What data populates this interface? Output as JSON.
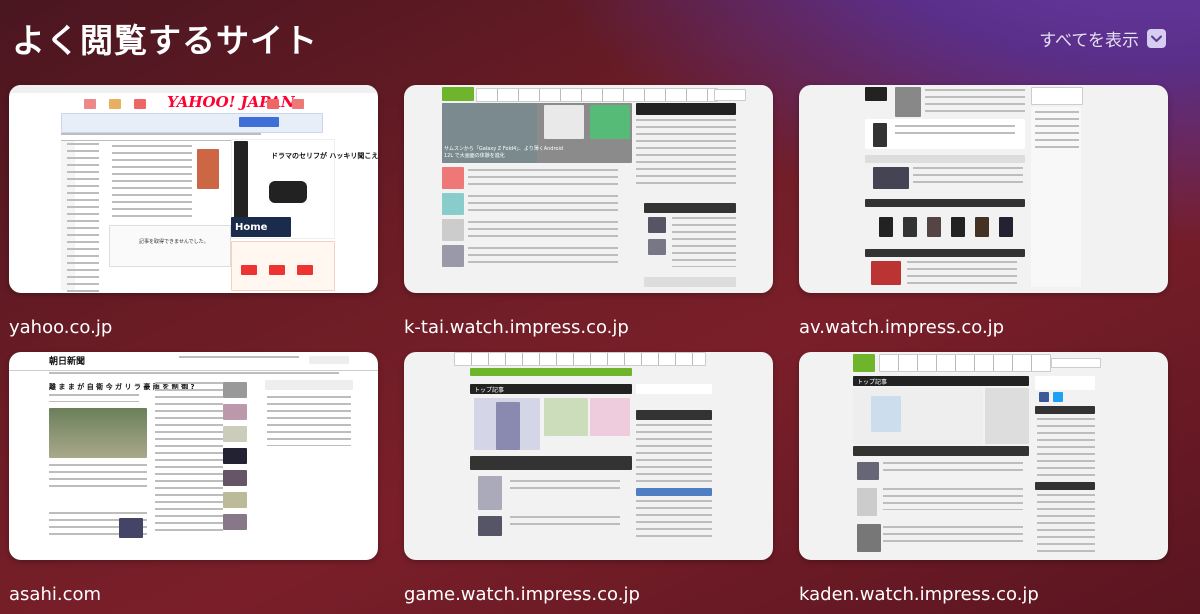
{
  "header": {
    "title": "よく閲覧するサイト",
    "show_all_label": "すべてを表示"
  },
  "tiles": [
    {
      "label": "yahoo.co.jp",
      "preview": {
        "logo": "YAHOO! JAPAN",
        "promo_text": "ドラマのセリフが ハッキリ聞こえる",
        "promo_footer": "Home",
        "notice": "記事を取得できませんでした。"
      }
    },
    {
      "label": "k-tai.watch.impress.co.jp",
      "preview": {
        "headline": "サムスンから「Galaxy Z Fold4」、より薄くAndroid 12L で大画面の体験を進化"
      }
    },
    {
      "label": "av.watch.impress.co.jp"
    },
    {
      "label": "asahi.com",
      "preview": {
        "logo": "朝日新聞",
        "headline": "離 ま ま が 自 衛 今 ガ リ ラ 豪 雨 を 制 御 ?"
      }
    },
    {
      "label": "game.watch.impress.co.jp",
      "preview": {
        "section": "トップ記事"
      }
    },
    {
      "label": "kaden.watch.impress.co.jp",
      "preview": {
        "section": "トップ記事"
      }
    }
  ],
  "colors": {
    "accent_purple": "#d7cdf0",
    "yahoo_red": "#ff0033",
    "impress_green": "#6fb52c"
  }
}
